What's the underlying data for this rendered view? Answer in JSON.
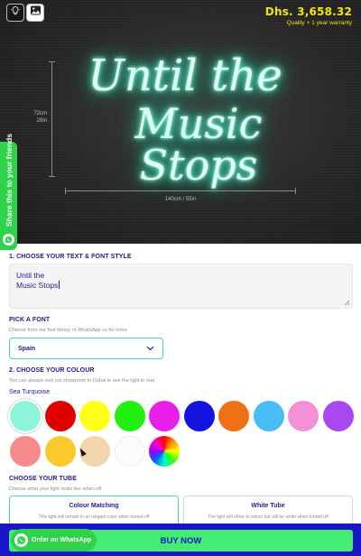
{
  "preview": {
    "price": "Dhs. 3,658.32",
    "price_note": "Quality + 1 year warranty",
    "neon_line1": "Until the",
    "neon_line2": "Music Stops",
    "height_label_cm": "72cm",
    "height_label_in": "28in",
    "width_label": "140cm / 55in",
    "share_label": "Share this to your friends",
    "neon_color": "#5ff2c8"
  },
  "text_section": {
    "title": "1. CHOOSE YOUR TEXT & FONT STYLE",
    "line1": "Until the",
    "line2": "Music Stops"
  },
  "font_section": {
    "title": "PICK A FONT",
    "subtitle": "Choose from our font library or WhatsApp us for more",
    "selected": "Spain"
  },
  "colour_section": {
    "title": "2. CHOOSE YOUR COLOUR",
    "subtitle": "You can always visit our showroom in Dubai to see the light in real",
    "selected_name": "Sea Turquoise",
    "swatches": [
      "#8ef5da",
      "#e00000",
      "#ffff1a",
      "#22ee10",
      "#e81fe8",
      "#1414e0",
      "#ee7010",
      "#47bcf5",
      "#f58fd8",
      "#a848ee",
      "#f58a8a",
      "#fbc92c",
      "#f2d4ad",
      "#fbfbfb",
      "rainbow"
    ]
  },
  "tube_section": {
    "title": "CHOOSE YOUR TUBE",
    "subtitle": "Choose what your light looks like when off",
    "options": [
      {
        "title": "Colour Matching",
        "desc": "This light will remain in an elegant color when turned off"
      },
      {
        "title": "White Tube",
        "desc": "The light will shine in colour but will be white when turned off"
      }
    ]
  },
  "bottom_bar": {
    "whatsapp_label": "Order on WhatsApp",
    "buy_label": "BUY NOW",
    "accent_green": "#44ec72",
    "accent_blue": "#1717c9"
  }
}
